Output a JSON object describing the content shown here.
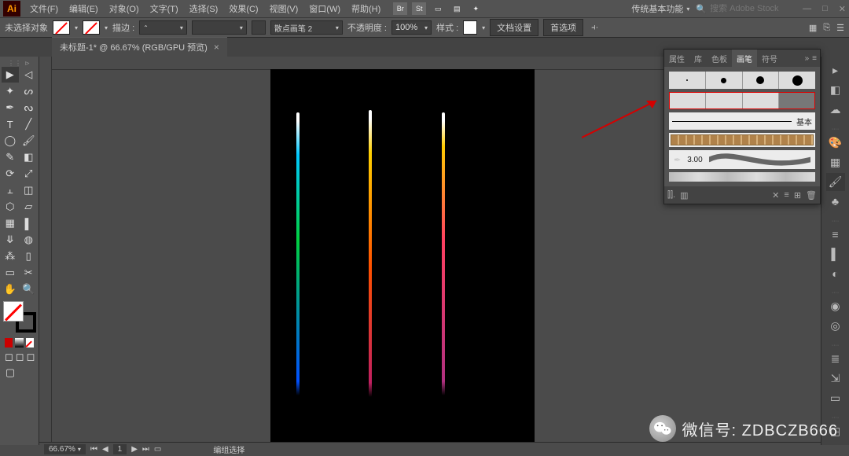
{
  "app": {
    "logo": "Ai"
  },
  "menu": [
    "文件(F)",
    "编辑(E)",
    "对象(O)",
    "文字(T)",
    "选择(S)",
    "效果(C)",
    "视图(V)",
    "窗口(W)",
    "帮助(H)"
  ],
  "menubar_icons": [
    "Br",
    "St"
  ],
  "workspace_switch": "传统基本功能",
  "search_placeholder": "搜索 Adobe Stock",
  "ctrl": {
    "no_selection": "未选择对象",
    "stroke_label": "描边 :",
    "stroke_style_label": "散点画笔 2",
    "opacity_label": "不透明度 :",
    "opacity_value": "100%",
    "style_label": "样式 :",
    "doc_setup": "文档设置",
    "prefs": "首选项"
  },
  "tab": {
    "title": "未标题-1* @ 66.67% (RGB/GPU 预览)"
  },
  "panel": {
    "tabs": [
      "属性",
      "库",
      "色板",
      "画笔",
      "符号"
    ],
    "active_tab": 3,
    "basic_label": "基本",
    "callig_size": "3.00"
  },
  "status": {
    "zoom": "66.67%",
    "page": "1",
    "mode": "编组选择"
  },
  "watermark": {
    "label": "微信号:",
    "id": "ZDBCZB666"
  }
}
